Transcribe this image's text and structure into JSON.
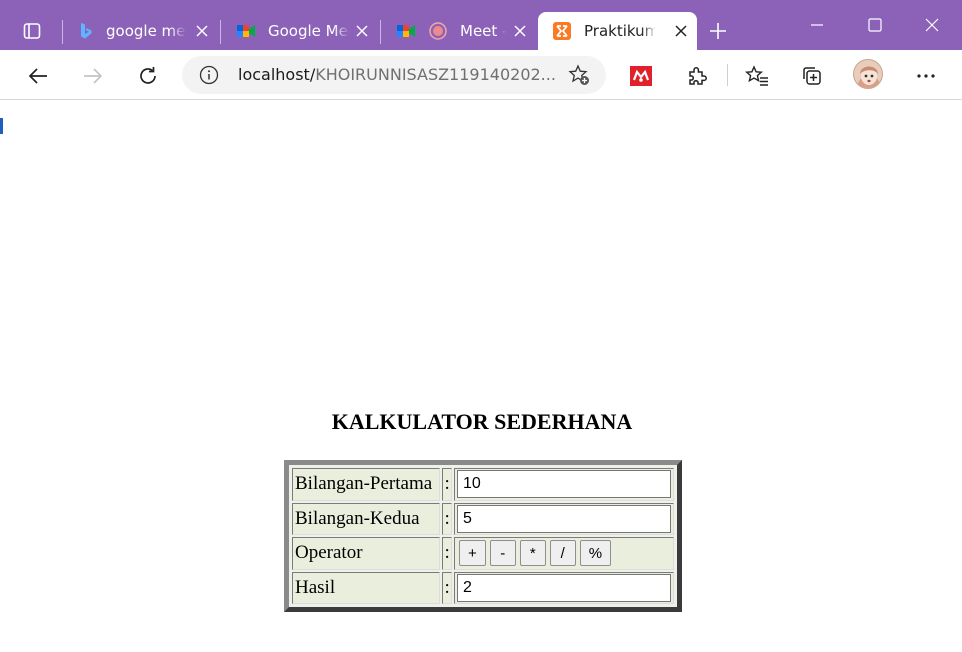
{
  "browser": {
    "tabs": [
      {
        "title": "google meet",
        "active": false
      },
      {
        "title": "Google Meet",
        "active": false
      },
      {
        "title": "Meet - ",
        "active": false,
        "recording": true
      },
      {
        "title": "Praktikum PHP",
        "active": true
      }
    ],
    "address": {
      "host": "localhost/",
      "path": "KHOIRUNNISASZ119140202..."
    },
    "colors": {
      "tabstrip": "#8c62b9",
      "active_tab": "#ffffff",
      "page_bg": "#ffffff"
    },
    "icons": {
      "tab_actions": "tab-actions-icon",
      "new_tab": "plus-icon",
      "back": "arrow-left-icon",
      "forward": "arrow-right-icon",
      "reload": "reload-icon",
      "site_info": "info-icon",
      "favorite": "star-add-icon",
      "extension": "puzzle-icon",
      "favorites": "favorites-icon",
      "collections": "collections-icon",
      "menu": "ellipsis-icon"
    }
  },
  "page": {
    "title": "KALKULATOR SEDERHANA",
    "rows": [
      {
        "label": "Bilangan-Pertama",
        "value": "10"
      },
      {
        "label": "Bilangan-Kedua",
        "value": "5"
      }
    ],
    "operator": {
      "label": "Operator",
      "buttons": [
        "+",
        "-",
        "*",
        "/",
        "%"
      ]
    },
    "result": {
      "label": "Hasil",
      "value": "2"
    },
    "colon": ":"
  }
}
